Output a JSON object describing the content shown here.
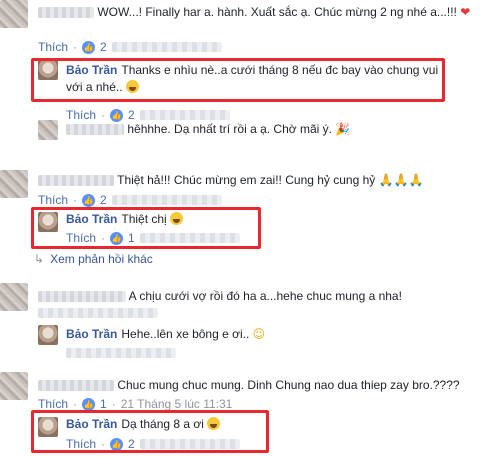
{
  "actions": {
    "like_label": "Thích",
    "dot": "·"
  },
  "comments": [
    {
      "id": "c1",
      "text": "WOW...! Finally har a. hành. Xuất sắc ạ. Chúc mừng 2 ng nhé a...!!!",
      "likes": "2"
    },
    {
      "id": "r1",
      "author": "Bảo Trần",
      "text_line1": "Thanks e nhìu nè..a cưới tháng 8 nếu đc bay vào chung vui",
      "text_line2": "với a nhé..",
      "likes": "2"
    },
    {
      "id": "r2",
      "text": "hêhhhe. Dạ nhất trí rồi a ạ. Chờ mãi ý."
    },
    {
      "id": "c2",
      "text": "Thiệt hả!!! Chúc mừng em zai!! Cung hỷ cung hỷ",
      "likes": "2"
    },
    {
      "id": "r3",
      "author": "Bảo Trần",
      "text": "Thiệt chị",
      "likes": "1"
    },
    {
      "id": "more",
      "text": "Xem phản hồi khác"
    },
    {
      "id": "c3",
      "text": "A chịu cưới vợ rồi đó ha a...hehe chuc mung a nha!"
    },
    {
      "id": "r4",
      "author": "Bảo Trần",
      "text": "Hehe..lên xe bông e ơi.."
    },
    {
      "id": "c4",
      "text": "Chuc mung chuc mung. Dinh Chung nao dua thiep zay bro.????",
      "likes": "1",
      "timestamp": "21 Tháng 5 lúc 11:31"
    },
    {
      "id": "r5",
      "author": "Bảo Trần",
      "text": "Dạ tháng 8 a ơi",
      "likes": "2"
    }
  ],
  "colors": {
    "highlight": "#e8282e",
    "link": "#365899",
    "like_badge": "#5890ff"
  }
}
